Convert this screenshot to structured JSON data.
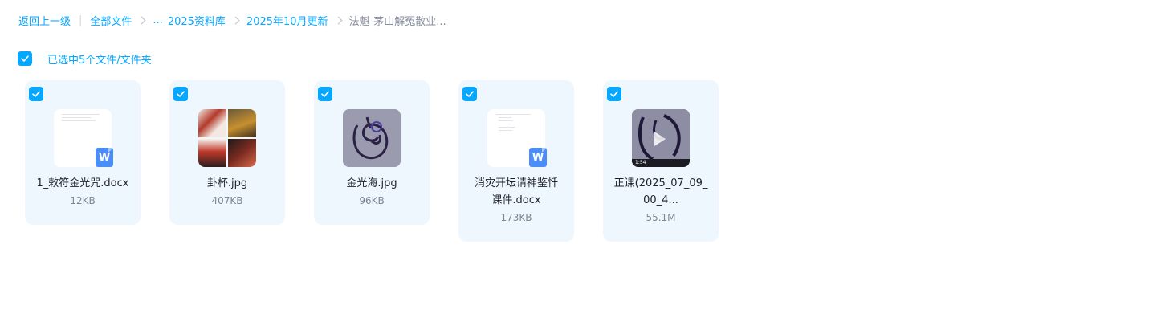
{
  "breadcrumb": {
    "back": "返回上一级",
    "divider": "|",
    "all_files": "全部文件",
    "ellipsis": "...",
    "level1": "2025资料库",
    "level2": "2025年10月更新",
    "current": "法魁-茅山解冤散业..."
  },
  "selection": {
    "text": "已选中5个文件/文件夹"
  },
  "colors": {
    "accent": "#06a7ff",
    "card_bg": "#eef7fd",
    "word_badge": "#4a8df8"
  },
  "files": [
    {
      "name_lines": [
        "1_敕符金光咒.docx"
      ],
      "size": "12KB",
      "type": "word",
      "icon": "word-doc-icon",
      "badge": "W"
    },
    {
      "name_lines": [
        "卦杯.jpg"
      ],
      "size": "407KB",
      "type": "image-collage",
      "icon": "image-thumbnail"
    },
    {
      "name_lines": [
        "金光海.jpg"
      ],
      "size": "96KB",
      "type": "image",
      "icon": "image-thumbnail"
    },
    {
      "name_lines": [
        "消灾开坛请神鉴忏",
        "课件.docx"
      ],
      "size": "173KB",
      "type": "word",
      "icon": "word-doc-icon",
      "badge": "W"
    },
    {
      "name_lines": [
        "正课(2025_07_09_",
        "00_4..."
      ],
      "size": "55.1M",
      "type": "video",
      "icon": "video-thumbnail",
      "duration": "1:54"
    }
  ]
}
